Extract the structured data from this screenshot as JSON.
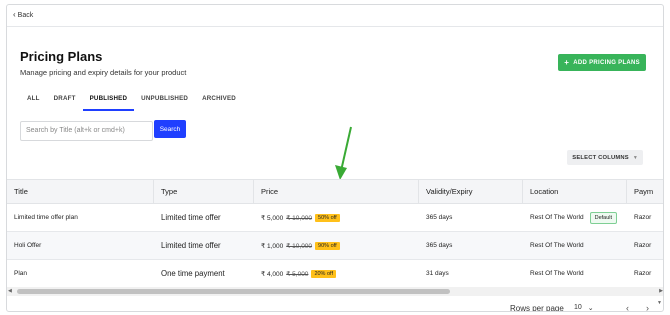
{
  "back": {
    "icon": "chevron-left-icon",
    "label": "Back"
  },
  "header": {
    "title": "Pricing Plans",
    "subtitle": "Manage pricing and expiry details for your product",
    "add_button": {
      "icon": "plus-icon",
      "label": "ADD PRICING PLANS"
    }
  },
  "tabs": [
    {
      "label": "ALL",
      "active": false
    },
    {
      "label": "DRAFT",
      "active": false
    },
    {
      "label": "PUBLISHED",
      "active": true
    },
    {
      "label": "UNPUBLISHED",
      "active": false
    },
    {
      "label": "ARCHIVED",
      "active": false
    }
  ],
  "search": {
    "placeholder": "Search by Title (alt+k or cmd+k)",
    "button_label": "Search"
  },
  "select_columns": {
    "label": "SELECT COLUMNS",
    "icon": "caret-down-icon"
  },
  "annotation": {
    "icon": "green-arrow-icon",
    "color": "#3aaa35"
  },
  "table": {
    "columns": [
      "Title",
      "Type",
      "Price",
      "Validity/Expiry",
      "Location",
      "Paym"
    ],
    "rows": [
      {
        "title": "Limited time offer plan",
        "type": "Limited time offer",
        "price": "₹ 5,000",
        "original_price": "₹ 10,000",
        "discount": "50% off",
        "validity": "365 days",
        "location": "Rest Of The World",
        "badge": "Default",
        "payment": "Razor"
      },
      {
        "title": "Holi Offer",
        "type": "Limited time offer",
        "price": "₹ 1,000",
        "original_price": "₹ 10,000",
        "discount": "90% off",
        "validity": "365 days",
        "location": "Rest Of The World",
        "badge": "",
        "payment": "Razor"
      },
      {
        "title": "Plan",
        "type": "One time payment",
        "price": "₹ 4,000",
        "original_price": "₹ 5,000",
        "discount": "20% off",
        "validity": "31 days",
        "location": "Rest Of The World",
        "badge": "",
        "payment": "Razor"
      }
    ]
  },
  "footer": {
    "rows_per_page_label": "Rows per page",
    "rows_per_page_value": "10",
    "prev_icon": "chevron-left-icon",
    "next_icon": "chevron-right-icon"
  },
  "colors": {
    "primary": "#1f3fff",
    "success": "#38b45a",
    "discount": "#ffc01a"
  }
}
